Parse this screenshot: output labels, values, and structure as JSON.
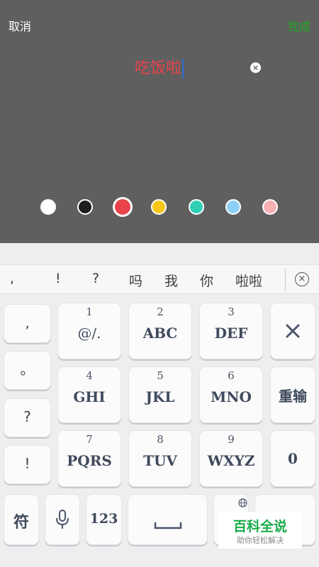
{
  "header": {
    "cancel_label": "取消",
    "done_label": "完成"
  },
  "editor": {
    "text": "吃饭啦",
    "text_color": "#e8434a"
  },
  "colors": [
    {
      "name": "white",
      "hex": "#ffffff",
      "selected": false
    },
    {
      "name": "black",
      "hex": "#1e1e1e",
      "selected": false
    },
    {
      "name": "red",
      "hex": "#e8434a",
      "selected": true
    },
    {
      "name": "yellow",
      "hex": "#f5c518",
      "selected": false
    },
    {
      "name": "teal",
      "hex": "#2ecfb3",
      "selected": false
    },
    {
      "name": "light-blue",
      "hex": "#8ecff7",
      "selected": false
    },
    {
      "name": "pink",
      "hex": "#f7b0b4",
      "selected": false
    }
  ],
  "candidates": [
    ",",
    "!",
    "?",
    "吗",
    "我",
    "你",
    "啦啦"
  ],
  "keyboard": {
    "side_keys": [
      ",",
      "。",
      "?",
      "!"
    ],
    "keys": [
      {
        "num": "1",
        "letters": "@/."
      },
      {
        "num": "2",
        "letters": "ABC"
      },
      {
        "num": "3",
        "letters": "DEF"
      },
      {
        "num": "4",
        "letters": "GHI"
      },
      {
        "num": "5",
        "letters": "JKL"
      },
      {
        "num": "6",
        "letters": "MNO"
      },
      {
        "num": "7",
        "letters": "PQRS"
      },
      {
        "num": "8",
        "letters": "TUV"
      },
      {
        "num": "9",
        "letters": "WXYZ"
      }
    ],
    "reinput_label": "重输",
    "zero_label": "0",
    "symbol_label": "符",
    "numeric_label": "123"
  },
  "watermark": {
    "title": "百科全说",
    "subtitle": "助你轻松解决"
  }
}
